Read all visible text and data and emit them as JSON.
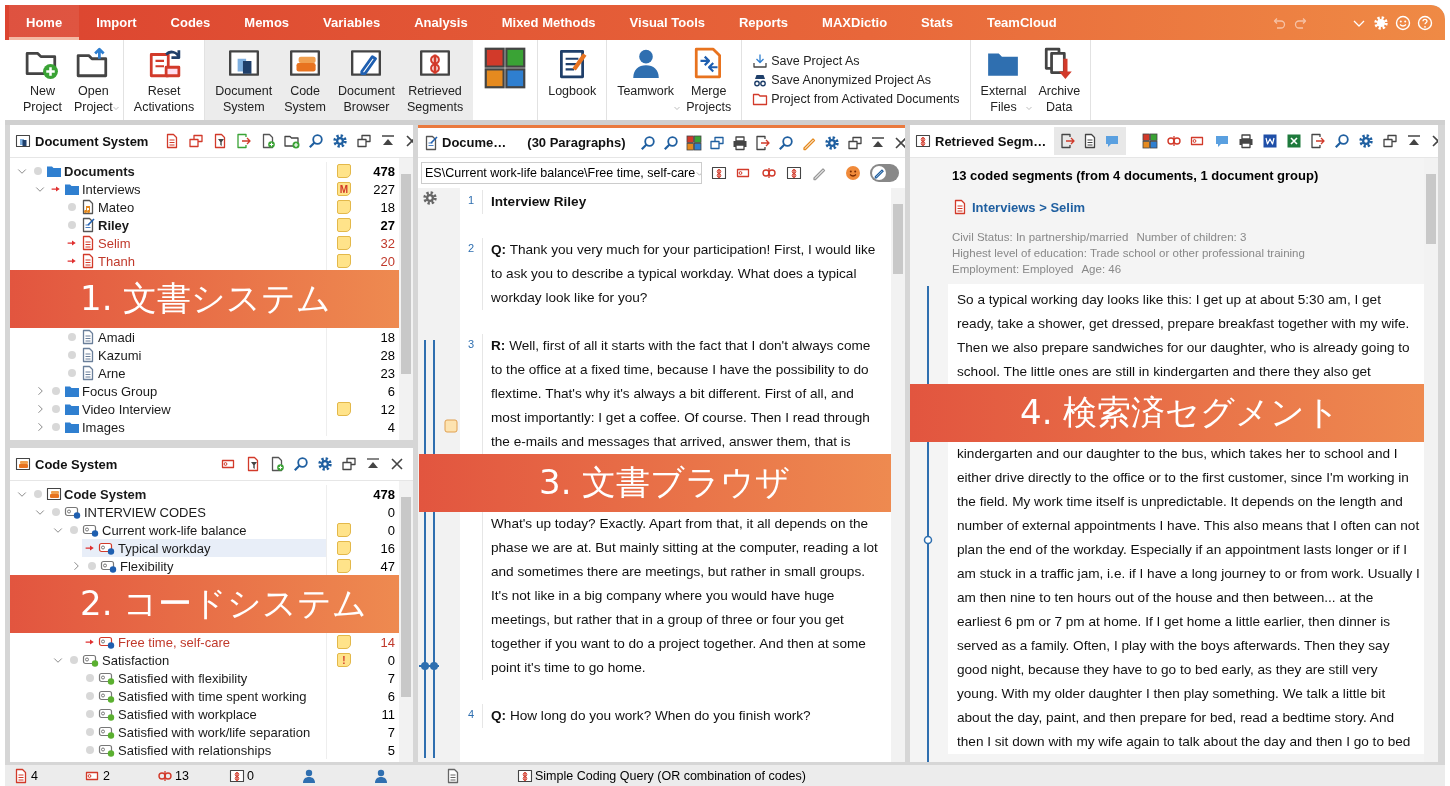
{
  "menu_tabs": [
    {
      "label": "Home",
      "selected": true
    },
    {
      "label": "Import",
      "selected": false
    },
    {
      "label": "Codes",
      "selected": false
    },
    {
      "label": "Memos",
      "selected": false
    },
    {
      "label": "Variables",
      "selected": false
    },
    {
      "label": "Analysis",
      "selected": false
    },
    {
      "label": "Mixed Methods",
      "selected": false
    },
    {
      "label": "Visual Tools",
      "selected": false
    },
    {
      "label": "Reports",
      "selected": false
    },
    {
      "label": "MAXDictio",
      "selected": false
    },
    {
      "label": "Stats",
      "selected": false
    },
    {
      "label": "TeamCloud",
      "selected": false
    }
  ],
  "ribbon": [
    {
      "kind": "buttons",
      "highlighted": false,
      "buttons": [
        {
          "label": "New Project",
          "dropdown": false
        },
        {
          "label": "Open Project",
          "dropdown": true
        }
      ]
    },
    {
      "kind": "buttons",
      "highlighted": false,
      "buttons": [
        {
          "label": "Reset Activations",
          "dropdown": false
        }
      ]
    },
    {
      "kind": "buttons",
      "highlighted": true,
      "buttons": [
        {
          "label": "Document System",
          "dropdown": false
        },
        {
          "label": "Code System",
          "dropdown": false
        },
        {
          "label": "Document Browser",
          "dropdown": false
        },
        {
          "label": "Retrieved Segments",
          "dropdown": false
        }
      ]
    },
    {
      "kind": "buttons",
      "highlighted": false,
      "buttons": [
        {
          "dropdown": false
        }
      ]
    },
    {
      "kind": "buttons",
      "highlighted": false,
      "buttons": [
        {
          "label": "Logbook",
          "dropdown": false
        }
      ]
    },
    {
      "kind": "buttons",
      "highlighted": false,
      "buttons": [
        {
          "label": "Teamwork",
          "dropdown": true
        },
        {
          "label": "Merge Projects",
          "dropdown": false
        }
      ]
    },
    {
      "kind": "stack",
      "highlighted": false,
      "buttons": [
        {
          "label": "Save Project As"
        },
        {
          "label": "Save Anonymized Project As"
        },
        {
          "label": "Project from Activated Documents"
        }
      ]
    },
    {
      "kind": "buttons",
      "highlighted": false,
      "buttons": [
        {
          "label": "External Files",
          "dropdown": true
        },
        {
          "label": "Archive Data",
          "dropdown": false
        }
      ]
    }
  ],
  "document_system": {
    "title": "Document System",
    "tree": [
      {
        "name": "Documents",
        "kind": "folder",
        "bold": true,
        "activated": false,
        "memo": true,
        "count": "478",
        "expanded": true,
        "children": [
          {
            "name": "Interviews",
            "kind": "folder",
            "activated": true,
            "memo": true,
            "memo_letter": "M",
            "count": "227",
            "expanded": true,
            "children": [
              {
                "name": "Mateo",
                "kind": "audio",
                "activated": false,
                "memo": true,
                "count": "18"
              },
              {
                "name": "Riley",
                "kind": "text",
                "bold": true,
                "activated": false,
                "memo": true,
                "count": "27"
              },
              {
                "name": "Selim",
                "kind": "document",
                "activated": true,
                "memo": true,
                "count": "32"
              },
              {
                "name": "Thanh",
                "kind": "document",
                "activated": true,
                "memo": true,
                "count": "20"
              },
              {
                "kind": "callout",
                "text": "1. 文書システム"
              },
              {
                "name": "Amadi",
                "kind": "document",
                "activated": false,
                "memo": false,
                "count": "18"
              },
              {
                "name": "Kazumi",
                "kind": "document",
                "activated": false,
                "memo": false,
                "count": "28"
              },
              {
                "name": "Arne",
                "kind": "document",
                "activated": false,
                "memo": false,
                "count": "23"
              }
            ]
          },
          {
            "name": "Focus Group",
            "kind": "folder",
            "activated": false,
            "memo": false,
            "count": "6",
            "expanded": false
          },
          {
            "name": "Video Interview",
            "kind": "folder",
            "activated": false,
            "memo": true,
            "count": "12",
            "expanded": false
          },
          {
            "name": "Images",
            "kind": "folder",
            "activated": false,
            "memo": false,
            "count": "4",
            "expanded": false
          }
        ]
      }
    ]
  },
  "code_system": {
    "title": "Code System",
    "tree": [
      {
        "name": "Code System",
        "kind": "root",
        "bold": true,
        "selected": false,
        "activated": false,
        "memo": false,
        "count": "478",
        "expanded": true,
        "children": [
          {
            "name": "INTERVIEW CODES",
            "kind": "code",
            "color": "#1f5fb0",
            "selected": false,
            "activated": false,
            "memo": false,
            "count": "0",
            "expanded": true,
            "children": [
              {
                "name": "Current work-life balance",
                "kind": "code",
                "color": "#1f5fb0",
                "selected": false,
                "activated": false,
                "memo": true,
                "count": "0",
                "expanded": true,
                "children": [
                  {
                    "name": "Typical workday",
                    "kind": "code",
                    "color": "#1f5fb0",
                    "selected": true,
                    "activated": true,
                    "memo": true,
                    "count": "16"
                  },
                  {
                    "name": "Flexibility",
                    "kind": "code",
                    "color": "#1f5fb0",
                    "selected": false,
                    "activated": false,
                    "memo": true,
                    "count": "47",
                    "expanded": false
                  },
                  {
                    "kind": "callout",
                    "text": "2. コードシステム"
                  },
                  {
                    "name": "Free time, self-care",
                    "kind": "code",
                    "color": "#1f5fb0",
                    "selected": false,
                    "activated": true,
                    "memo": true,
                    "count": "14"
                  }
                ]
              },
              {
                "name": "Satisfaction",
                "kind": "code",
                "color": "#5bb030",
                "selected": false,
                "activated": false,
                "memo": true,
                "memo_letter": "!",
                "count": "0",
                "expanded": true,
                "children": [
                  {
                    "name": "Satisfied with flexibility",
                    "kind": "code",
                    "color": "#5bb030",
                    "selected": false,
                    "activated": false,
                    "memo": false,
                    "count": "7"
                  },
                  {
                    "name": "Satisfied with time spent working",
                    "kind": "code",
                    "color": "#5bb030",
                    "selected": false,
                    "activated": false,
                    "memo": false,
                    "count": "6"
                  },
                  {
                    "name": "Satisfied with workplace",
                    "kind": "code",
                    "color": "#5bb030",
                    "selected": false,
                    "activated": false,
                    "memo": false,
                    "count": "11"
                  },
                  {
                    "name": "Satisfied with work/life separation",
                    "kind": "code",
                    "color": "#5bb030",
                    "selected": false,
                    "activated": false,
                    "memo": false,
                    "count": "7"
                  },
                  {
                    "name": "Satisfied with relationships",
                    "kind": "code",
                    "color": "#5bb030",
                    "selected": false,
                    "activated": false,
                    "memo": false,
                    "count": "5"
                  }
                ]
              }
            ]
          }
        ]
      }
    ]
  },
  "document_browser": {
    "title": "Docume…",
    "subtitle": "(30 Paragraphs)",
    "code_path": "ES\\Current work-life balance\\Free time, self-care",
    "edit_mode": {
      "on": false
    },
    "paragraphs": [
      {
        "number": "1",
        "heading": true,
        "parts": [
          {
            "kind": "text",
            "text": "Interview Riley"
          }
        ]
      },
      {
        "number": "2",
        "heading": false,
        "parts": [
          {
            "kind": "text",
            "text": "**Q:** Thank you very much for your participation! First, I would like to ask you to describe a typical workday. What does a typical workday look like for you?"
          }
        ]
      },
      {
        "number": "3",
        "heading": false,
        "parts": [
          {
            "kind": "text",
            "text": "**R:** Well, first of all it starts with the fact that I don't always come to the office at a fixed time, because I have the possibility to do flextime. That's why it's always a bit different. First of all, and most importantly: I get a coffee. Of course. Then I read through the e-mails and messages that arrived, answer them, that is"
          },
          {
            "kind": "callout",
            "text": "3. 文書ブラウザ"
          },
          {
            "kind": "text",
            "text": "What's up today? Exactly. Apart from that, it all depends on the phase we are at. But mainly sitting at the computer, reading a lot and sometimes there are meetings, but rather in small groups. It's not like in a big company where you would have huge meetings, but rather that in a group of three or four you get together if you want to do a project together. And then at some point it's time to go home."
          }
        ]
      },
      {
        "number": "4",
        "heading": false,
        "parts": [
          {
            "kind": "text",
            "text": "**Q:** How long do you work? When do you finish work?"
          }
        ]
      }
    ]
  },
  "retrieved_segments": {
    "title": "Retrieved Segm…",
    "summary": "13 coded segments (from 4 documents, 1 document group)",
    "source": "Interviews > Selim",
    "attributes": [
      "Civil Status: In partnership/married",
      "Number of children: 3",
      "Highest level of education: Trade school or other professional training",
      "Employment: Employed",
      "Age: 46"
    ],
    "parts": [
      {
        "kind": "text",
        "text": "So a typical working day looks like this: I get up at about 5:30 am, I get ready, take a shower, get dressed, prepare breakfast together with my wife. Then we also prepare sandwiches for our daughter, who is already going to school. The little ones are still in kindergarten and there they also get"
      },
      {
        "kind": "callout",
        "text": "4. 検索済セグメント"
      },
      {
        "kind": "text",
        "text": "kindergarten and our daughter to the bus, which takes her to school and I either drive directly to the office or to the first customer, since I'm working in the field. My work time itself is unpredictable. It depends on the length and number of external appointments I have. This also means that I often can not plan the end of the workday. Especially if an appointment lasts longer or if I am stuck in a traffic jam, i.e. if I have a long journey to or from work. Usually I am then nine to ten hours out of the house and then between... at the earliest 6 pm or 7 pm at home. If I get home a little earlier, then dinner is served as a family. Often, I play with the boys afterwards. Then they say good night, because they have to go to bed early, as they are still very young. With my older daughter I then play something. We talk a little bit about the day, paint, and then prepare for bed, read a bedtime story. And then I sit down with my wife again to talk about the day and then I go to bed"
      }
    ]
  },
  "status_bar": {
    "items": [
      {
        "kind": "documents",
        "text": "4"
      },
      {
        "kind": "codes",
        "text": "2"
      },
      {
        "kind": "segments",
        "text": "13"
      },
      {
        "kind": "memos",
        "text": "0"
      },
      {
        "kind": "teamwork"
      },
      {
        "kind": "user"
      },
      {
        "kind": "document"
      },
      {
        "kind": "query",
        "text": "Simple Coding Query (OR combination of codes)"
      }
    ]
  }
}
